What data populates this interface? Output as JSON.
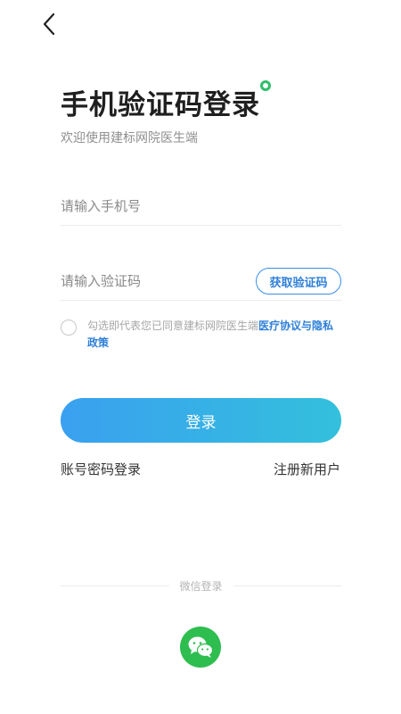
{
  "header": {
    "back_icon": "chevron-left-icon"
  },
  "title": "手机验证码登录",
  "subtitle": "欢迎使用建标网院医生端",
  "phone": {
    "placeholder": "请输入手机号",
    "value": ""
  },
  "code": {
    "placeholder": "请输入验证码",
    "value": "",
    "get_code_label": "获取验证码"
  },
  "agreement": {
    "checked": false,
    "prefix": "勾选即代表您已同意建标网院医生端",
    "link": "医疗协议与隐私政策"
  },
  "login_label": "登录",
  "password_login_label": "账号密码登录",
  "register_label": "注册新用户",
  "wechat": {
    "divider_label": "微信登录",
    "icon": "wechat-icon"
  },
  "colors": {
    "accent": "#2f80d8",
    "gradient_start": "#3aa0f0",
    "gradient_end": "#33c0dc",
    "wechat_green": "#2ebd4f"
  }
}
